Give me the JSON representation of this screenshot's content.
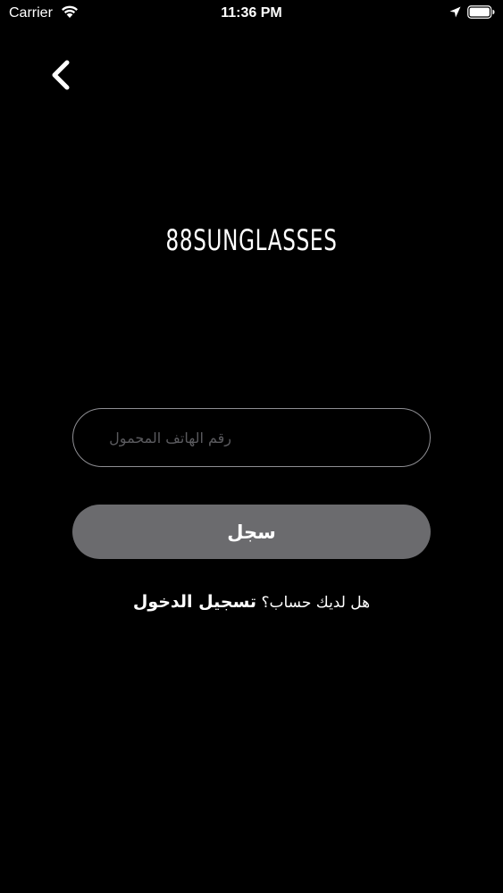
{
  "status_bar": {
    "carrier": "Carrier",
    "time": "11:36 PM"
  },
  "header": {
    "back_icon": "chevron-left-icon"
  },
  "brand": {
    "title": "88SUNGLASSES"
  },
  "form": {
    "phone_placeholder": "رقم الهاتف المحمول",
    "phone_value": "",
    "register_label": "سجل"
  },
  "footer": {
    "prompt": "هل لديك حساب؟",
    "login_link": "تسجيل الدخول"
  },
  "colors": {
    "background": "#000000",
    "text": "#ffffff",
    "input_border": "#8e8e93",
    "placeholder": "#5a5a5e",
    "button_bg": "#6b6b6e"
  }
}
